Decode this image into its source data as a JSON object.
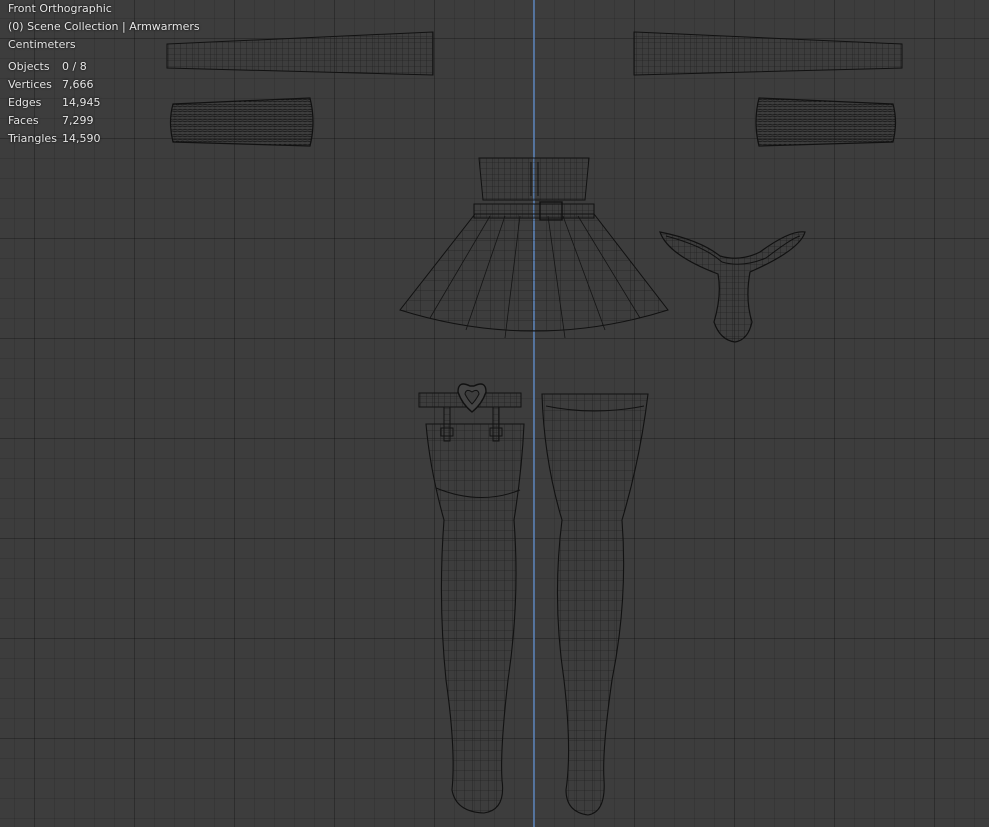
{
  "viewport": {
    "view_name": "Front Orthographic",
    "collection": "(0) Scene Collection | Armwarmers",
    "units": "Centimeters",
    "axis_color": "#5a7fb0",
    "background_color": "#3d3d3d"
  },
  "stats": [
    {
      "label": "Objects",
      "value": "0 / 8"
    },
    {
      "label": "Vertices",
      "value": "7,666"
    },
    {
      "label": "Edges",
      "value": "14,945"
    },
    {
      "label": "Faces",
      "value": "7,299"
    },
    {
      "label": "Triangles",
      "value": "14,590"
    }
  ],
  "objects": [
    {
      "name": "armwarmer-left"
    },
    {
      "name": "armwarmer-right"
    },
    {
      "name": "scrunch-cuff-left"
    },
    {
      "name": "scrunch-cuff-right"
    },
    {
      "name": "pleated-skirt"
    },
    {
      "name": "thong"
    },
    {
      "name": "garter-belt"
    },
    {
      "name": "thigh-high-stocking-left"
    },
    {
      "name": "thigh-high-stocking-right"
    }
  ]
}
